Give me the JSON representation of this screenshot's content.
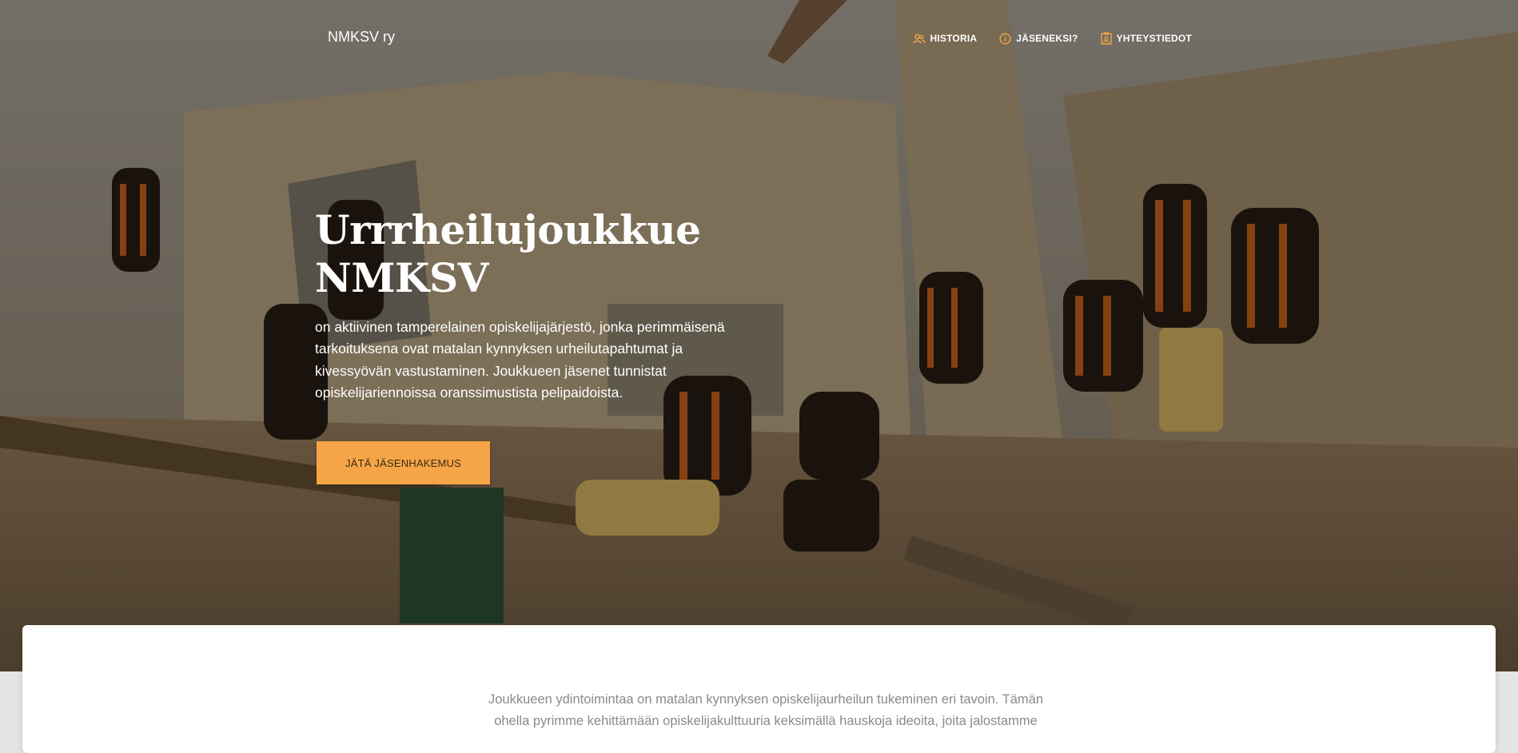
{
  "navbar": {
    "brand": "NMKSV ry",
    "links": [
      {
        "label": "HISTORIA",
        "icon": "group-icon"
      },
      {
        "label": "JÄSENEKSI?",
        "icon": "info-icon"
      },
      {
        "label": "YHTEYSTIEDOT",
        "icon": "contact-card-icon"
      }
    ]
  },
  "hero": {
    "title_line1": "Urrrheilujoukkue",
    "title_line2": "NMKSV",
    "description": "on aktiivinen tamperelainen opiskelijajärjestö, jonka perimmäisenä tarkoituksena ovat matalan kynnyksen urheilutapahtumat ja kivessyövän vastustaminen. Joukkueen jäsenet tunnistat opiskelijariennoissa oranssimustista pelipaidoista.",
    "cta_label": "JÄTÄ JÄSENHAKEMUS"
  },
  "content": {
    "intro": "Joukkueen ydintoimintaa on matalan kynnyksen opiskelijaurheilun tukeminen eri tavoin. Tämän ohella pyrimme kehittämään opiskelijakulttuuria keksimällä hauskoja ideoita, joita jalostamme"
  },
  "colors": {
    "accent": "#f5a547",
    "nav_icon": "#f5a547",
    "overlay": "rgba(0,0,0,0.38)"
  }
}
